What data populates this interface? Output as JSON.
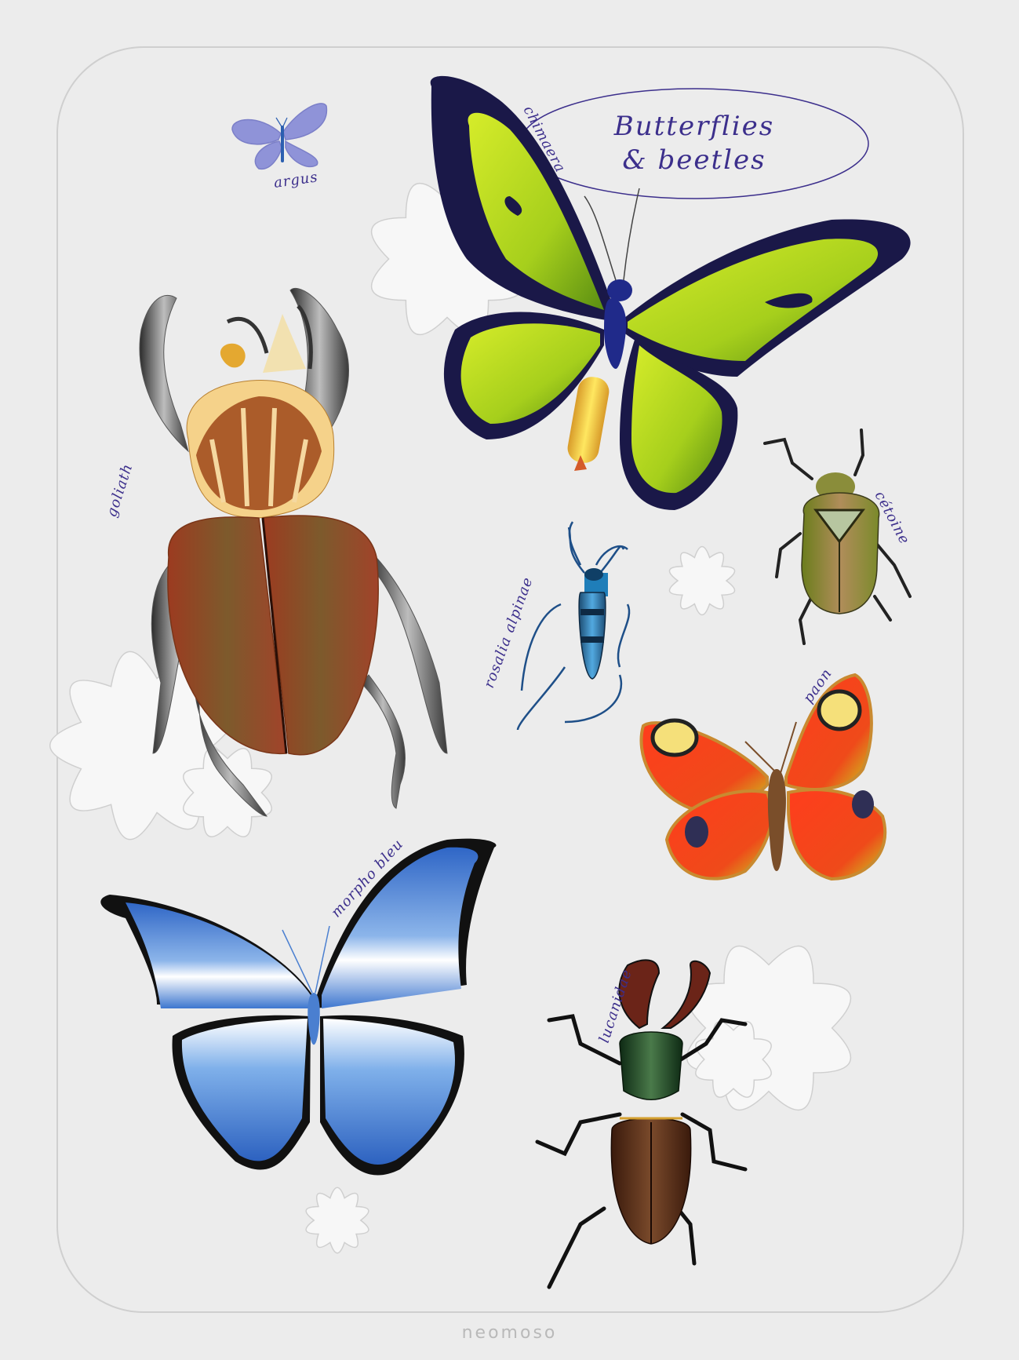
{
  "poster": {
    "title_line1": "Butterflies",
    "title_line2": "& beetles",
    "brand": "neomoso",
    "colors": {
      "background": "#ececec",
      "card_border": "#cfcfcf",
      "label_ink": "#3c2f8c",
      "flower": "#f7f7f7"
    }
  },
  "specimens": [
    {
      "label": "argus",
      "kind": "butterfly"
    },
    {
      "label": "chimaera",
      "kind": "butterfly"
    },
    {
      "label": "goliath",
      "kind": "beetle"
    },
    {
      "label": "cétoine",
      "kind": "beetle"
    },
    {
      "label": "rosalia alpinae",
      "kind": "beetle"
    },
    {
      "label": "paon",
      "kind": "butterfly"
    },
    {
      "label": "morpho bleu",
      "kind": "butterfly"
    },
    {
      "label": "lucanidae",
      "kind": "beetle"
    }
  ]
}
